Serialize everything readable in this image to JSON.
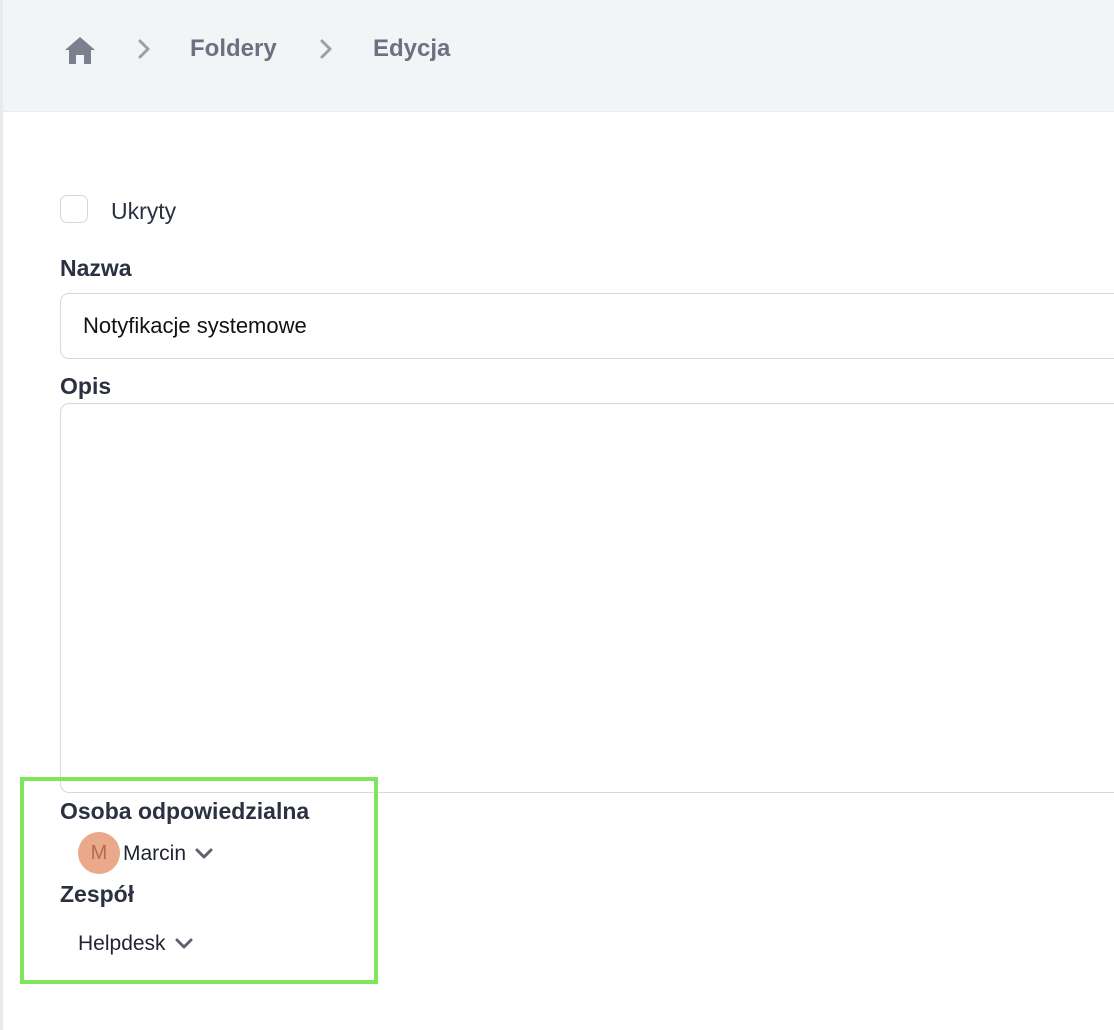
{
  "breadcrumb": {
    "home_icon": "home-icon",
    "items": [
      "Foldery",
      "Edycja"
    ]
  },
  "form": {
    "hidden_label": "Ukryty",
    "hidden_checked": false,
    "name_label": "Nazwa",
    "name_value": "Notyfikacje systemowe",
    "description_label": "Opis",
    "description_value": "",
    "owner_label": "Osoba odpowiedzialna",
    "owner_initial": "M",
    "owner_name": "Marcin",
    "team_label": "Zespół",
    "team_value": "Helpdesk"
  },
  "colors": {
    "highlight": "#7ee65c",
    "avatar_bg": "#e9a98a",
    "topbar_bg": "#f3f4f6"
  }
}
